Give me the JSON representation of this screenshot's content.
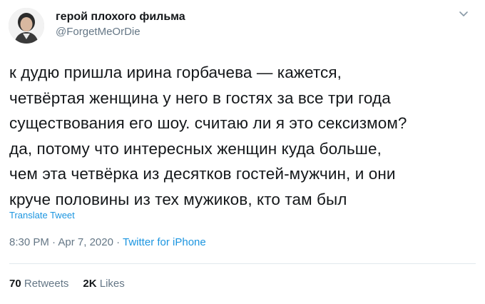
{
  "author": {
    "name": "герой плохого фильма",
    "handle": "@ForgetMeOrDie"
  },
  "icons": {
    "avatar": "avatar-photo",
    "menu": "chevron-down-icon"
  },
  "tweet": {
    "lines": [
      "к дудю пришла ирина горбачева — кажется,",
      "четвёртая женщина у него в гостях за все три года",
      "существования его шоу. считаю ли я это сексизмом?",
      "да, потому что интересных женщин куда больше,",
      "чем эта четвёрка из десятков гостей-мужчин, и они",
      "круче половины из тех мужиков, кто там был"
    ],
    "translate_label": "Translate Tweet",
    "time": "8:30 PM",
    "separator": " · ",
    "date": "Apr 7, 2020",
    "source": "Twitter for iPhone"
  },
  "stats": {
    "retweets_count": "70",
    "retweets_label": "Retweets",
    "likes_count": "2K",
    "likes_label": "Likes"
  },
  "colors": {
    "link": "#1b95e0",
    "secondary": "#657786",
    "text": "#14171a",
    "divider": "#e1e8ed"
  }
}
